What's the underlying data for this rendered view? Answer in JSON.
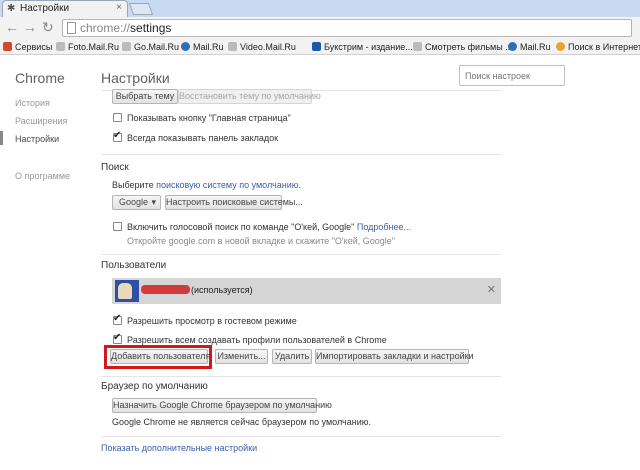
{
  "tab": {
    "title": "Настройки",
    "close_icon": "×"
  },
  "toolbar": {
    "url_scheme": "chrome://",
    "url_path": "settings"
  },
  "bookmarks": [
    {
      "label": "Сервисы",
      "color": "#d04a2b"
    },
    {
      "label": "Foto.Mail.Ru",
      "color": "#999999"
    },
    {
      "label": "Go.Mail.Ru",
      "color": "#999999"
    },
    {
      "label": "Mail.Ru",
      "color": "#2d6fb6"
    },
    {
      "label": "Video.Mail.Ru",
      "color": "#999999"
    },
    {
      "label": "Букстрим - издание...",
      "color": "#1a5ba8"
    },
    {
      "label": "Смотреть фильмы ...",
      "color": "#999999"
    },
    {
      "label": "Mail.Ru",
      "color": "#2d6fb6"
    },
    {
      "label": "Поиск в Интернете",
      "color": "#f0a030"
    }
  ],
  "leftnav": {
    "title": "Chrome",
    "items": [
      "История",
      "Расширения",
      "Настройки"
    ],
    "about": "О программе"
  },
  "main": {
    "title": "Настройки",
    "search_placeholder": "Поиск настроек",
    "appearance": {
      "choose_theme": "Выбрать тему",
      "restore_theme": "Восстановить тему по умолчанию",
      "show_home": "Показывать кнопку \"Главная страница\"",
      "show_bookmarks": "Всегда показывать панель закладок"
    },
    "search": {
      "heading": "Поиск",
      "text_before": "Выберите ",
      "link": "поисковую систему по умолчанию",
      "text_after": ".",
      "engine": "Google",
      "configure": "Настроить поисковые системы...",
      "voice_label": "Включить голосовой поиск по команде \"О'кей, Google\" ",
      "voice_link": "Подробнее...",
      "voice_hint": "Откройте google.com в новой вкладке и скажите \"О'кей, Google\""
    },
    "users": {
      "heading": "Пользователи",
      "current_suffix": "(используется)",
      "guest": "Разрешить просмотр в гостевом режиме",
      "allow_profiles": "Разрешить всем создавать профили пользователей в Chrome",
      "add_user": "Добавить пользователя",
      "edit": "Изменить...",
      "delete": "Удалить",
      "import": "Импортировать закладки и настройки"
    },
    "default_browser": {
      "heading": "Браузер по умолчанию",
      "make_default": "Назначить Google Chrome браузером по умолчанию",
      "status": "Google Chrome не является сейчас браузером по умолчанию."
    },
    "show_advanced": "Показать дополнительные настройки"
  },
  "colors": {
    "highlight": "#d4171b",
    "link": "#3b5faa"
  }
}
